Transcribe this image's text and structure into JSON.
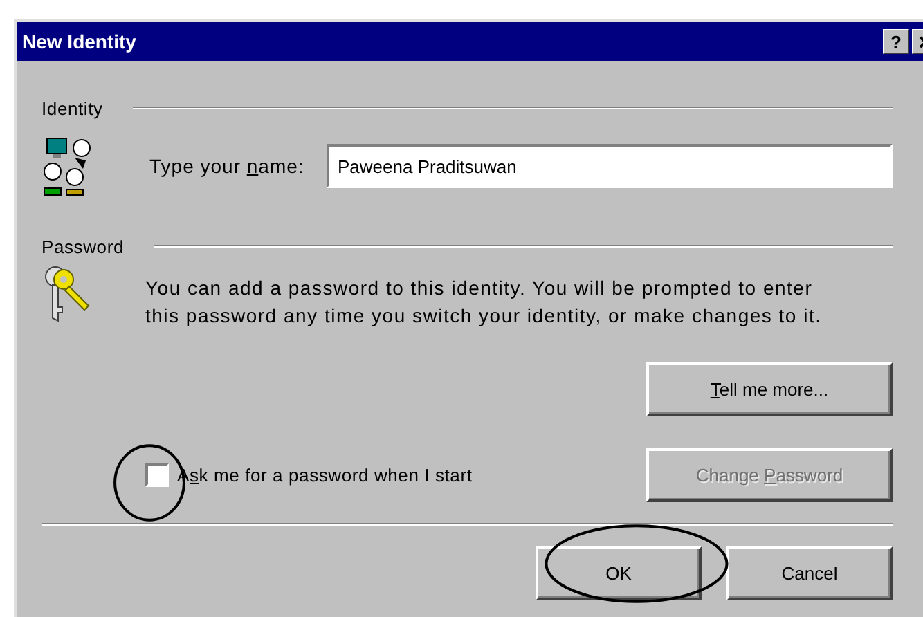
{
  "window": {
    "title": "New Identity",
    "help_button": "?"
  },
  "identity": {
    "heading": "Identity",
    "name_label": {
      "before": "Type your ",
      "access_key": "n",
      "after": "ame:"
    },
    "name_value": "Paweena Praditsuwan"
  },
  "password": {
    "heading": "Password",
    "description_lines": [
      "You can add a password to this identity.  You will be prompted to enter",
      "this password any time you switch your identity, or make changes to it."
    ],
    "tell_more": {
      "access_key": "T",
      "after": "ell me more...",
      "disabled": false
    },
    "ask_checkbox": {
      "before": "A",
      "access_key": "s",
      "after": "k me for a password when I start",
      "checked": false
    },
    "change_password": {
      "before": "Change ",
      "access_key": "P",
      "after": "assword",
      "disabled": true
    }
  },
  "buttons": [
    {
      "label": "OK"
    },
    {
      "label": "Cancel"
    }
  ],
  "annotations": [
    {
      "kind": "circle"
    },
    {
      "kind": "circle"
    }
  ]
}
